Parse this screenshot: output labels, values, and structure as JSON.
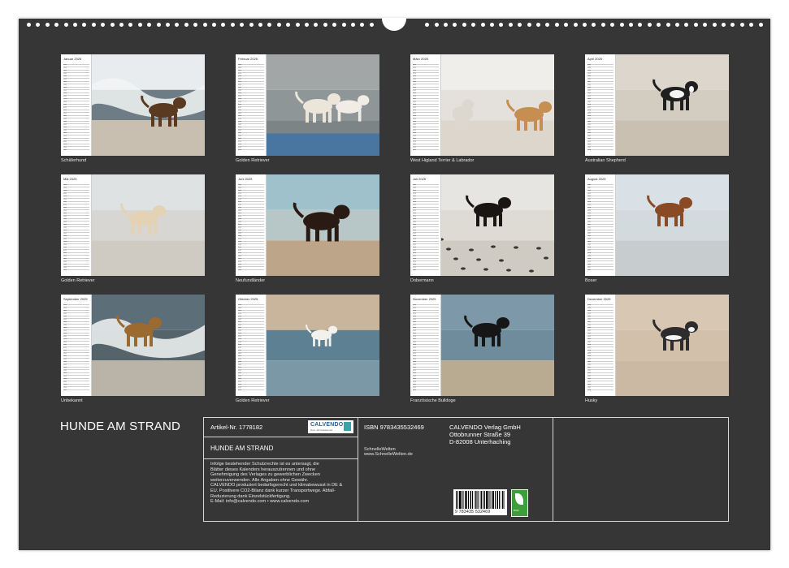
{
  "months": [
    {
      "month": "Januar 2025",
      "caption": "Schäferhund"
    },
    {
      "month": "Februar 2025",
      "caption": "Golden Retriever"
    },
    {
      "month": "März 2025",
      "caption": "West Higland Terrier & Labrador"
    },
    {
      "month": "April 2025",
      "caption": "Australian Shepherd"
    },
    {
      "month": "Mai 2025",
      "caption": "Golden Retriever"
    },
    {
      "month": "Juni 2025",
      "caption": "Neufundländer"
    },
    {
      "month": "Juli 2025",
      "caption": "Dobermann"
    },
    {
      "month": "August 2025",
      "caption": "Boxer"
    },
    {
      "month": "September 2025",
      "caption": "Unbekannt"
    },
    {
      "month": "Oktober 2025",
      "caption": "Golden Retriever"
    },
    {
      "month": "November 2025",
      "caption": "Französische Bulldoge"
    },
    {
      "month": "Dezember 2025",
      "caption": "Husky"
    }
  ],
  "title": "HUNDE AM STRAND",
  "info": {
    "article": "Artikel-Nr. 1778182",
    "logo": "CALVENDO",
    "logo_sub": "Dein Jahreskalender",
    "product_title": "HUNDE AM STRAND",
    "legal": [
      "Infolge bestehender Schutzrechte ist es untersagt, die",
      "Blätter dieses Kalenders herauszutrennen und ohne",
      "Genehmigung des Verlages zu gewerblichen Zwecken",
      "weiterzuverwenden. Alle Angaben ohne Gewähr.",
      "CALVENDO produziert bedarfsgerecht und klimabewusst in DE &",
      "EU. Positivere CO2-Bilanz dank kurzer Transportwege. Abfall-",
      "Reduzierung dank Einzelstückfertigung.",
      "E-Mail: info@calvendo.com • www.calvendo.com"
    ],
    "isbn": "ISBN 9783435532469",
    "author": "SchnelleWelten",
    "author_url": "www.SchnelleWelten.de",
    "publisher": [
      "CALVENDO Verlag GmbH",
      "Ottobrunner Straße 39",
      "D-82008 Unterhaching"
    ],
    "barcode_digits": "9 783435 532469",
    "eco_label": "eco"
  }
}
